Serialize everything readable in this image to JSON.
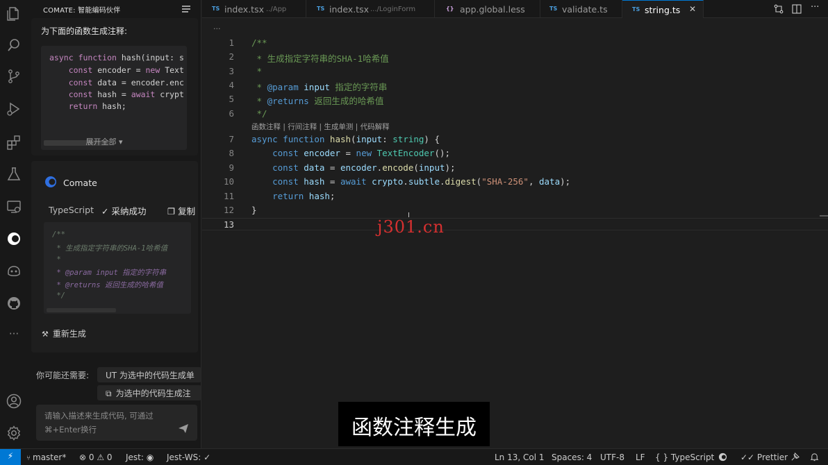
{
  "activity_bar": {
    "icons": [
      "explorer-icon",
      "search-icon",
      "source-control-icon",
      "run-debug-icon",
      "extensions-icon",
      "testing-icon",
      "remote-explorer-icon",
      "comate-icon",
      "copilot-icon",
      "github-icon",
      "more-icon",
      "account-icon",
      "settings-icon"
    ],
    "more_label": "···"
  },
  "side_panel": {
    "title": "COMATE: 智能编码伙伴",
    "user_message": {
      "prompt": "为下面的函数生成注释:",
      "code_lines": [
        "async function hash(input: s",
        "    const encoder = new Text",
        "    const data = encoder.enc",
        "    const hash = await crypt",
        "    return hash;"
      ],
      "expand_label": "展开全部 ▾"
    },
    "bot_message": {
      "name": "Comate",
      "language": "TypeScript",
      "accept_label": "✓ 采纳成功",
      "copy_label": "❐ 复制",
      "code_lines": [
        "/**",
        " * 生成指定字符串的SHA-1哈希值",
        " *",
        " * @param input 指定的字符串",
        " * @returns 返回生成的哈希值",
        " */"
      ],
      "regenerate_label": "重新生成"
    },
    "suggestions_label": "你可能还需要:",
    "suggestions": [
      "UT  为选中的代码生成单",
      "为选中的代码生成注"
    ],
    "prompt_placeholder_line1": "请输入描述来生成代码, 可通过",
    "prompt_placeholder_line2": "⌘+Enter换行"
  },
  "tabs": [
    {
      "badge": "TS",
      "name": "index.tsx",
      "path": "../App"
    },
    {
      "badge": "TS",
      "name": "index.tsx",
      "path": ".../LoginForm"
    },
    {
      "badge": "{}",
      "name": "app.global.less",
      "path": ""
    },
    {
      "badge": "TS",
      "name": "validate.ts",
      "path": ""
    },
    {
      "badge": "TS",
      "name": "string.ts",
      "path": "",
      "active": true
    }
  ],
  "tab_close": "✕",
  "editor": {
    "breadcrumb": "···",
    "line_numbers": [
      "1",
      "2",
      "3",
      "4",
      "5",
      "6",
      "7",
      "8",
      "9",
      "10",
      "11",
      "12",
      "13"
    ],
    "codelens": "函数注释 | 行间注释 | 生成单测 | 代码解释",
    "lines": [
      [
        {
          "t": "/**",
          "c": "com"
        }
      ],
      [
        {
          "t": " * 生成指定字符串的SHA-1哈希值",
          "c": "com"
        }
      ],
      [
        {
          "t": " *",
          "c": "com"
        }
      ],
      [
        {
          "t": " * ",
          "c": "com"
        },
        {
          "t": "@param",
          "c": "jsd"
        },
        {
          "t": " ",
          "c": "com"
        },
        {
          "t": "input",
          "c": "var"
        },
        {
          "t": " 指定的字符串",
          "c": "com"
        }
      ],
      [
        {
          "t": " * ",
          "c": "com"
        },
        {
          "t": "@returns",
          "c": "jsd"
        },
        {
          "t": " 返回生成的哈希值",
          "c": "com"
        }
      ],
      [
        {
          "t": " */",
          "c": "com"
        }
      ],
      [
        {
          "t": "async",
          "c": "key"
        },
        {
          "t": " ",
          "c": "pun"
        },
        {
          "t": "function",
          "c": "key"
        },
        {
          "t": " ",
          "c": "pun"
        },
        {
          "t": "hash",
          "c": "fn"
        },
        {
          "t": "(",
          "c": "pun"
        },
        {
          "t": "input",
          "c": "var"
        },
        {
          "t": ": ",
          "c": "pun"
        },
        {
          "t": "string",
          "c": "cls"
        },
        {
          "t": ") {",
          "c": "pun"
        }
      ],
      [
        {
          "t": "    ",
          "c": "pun"
        },
        {
          "t": "const",
          "c": "key"
        },
        {
          "t": " ",
          "c": "pun"
        },
        {
          "t": "encoder",
          "c": "var"
        },
        {
          "t": " = ",
          "c": "pun"
        },
        {
          "t": "new",
          "c": "key"
        },
        {
          "t": " ",
          "c": "pun"
        },
        {
          "t": "TextEncoder",
          "c": "cls"
        },
        {
          "t": "();",
          "c": "pun"
        }
      ],
      [
        {
          "t": "    ",
          "c": "pun"
        },
        {
          "t": "const",
          "c": "key"
        },
        {
          "t": " ",
          "c": "pun"
        },
        {
          "t": "data",
          "c": "var"
        },
        {
          "t": " = ",
          "c": "pun"
        },
        {
          "t": "encoder",
          "c": "var"
        },
        {
          "t": ".",
          "c": "pun"
        },
        {
          "t": "encode",
          "c": "fn"
        },
        {
          "t": "(",
          "c": "pun"
        },
        {
          "t": "input",
          "c": "var"
        },
        {
          "t": ");",
          "c": "pun"
        }
      ],
      [
        {
          "t": "    ",
          "c": "pun"
        },
        {
          "t": "const",
          "c": "key"
        },
        {
          "t": " ",
          "c": "pun"
        },
        {
          "t": "hash",
          "c": "var"
        },
        {
          "t": " = ",
          "c": "pun"
        },
        {
          "t": "await",
          "c": "key"
        },
        {
          "t": " ",
          "c": "pun"
        },
        {
          "t": "crypto",
          "c": "var"
        },
        {
          "t": ".",
          "c": "pun"
        },
        {
          "t": "subtle",
          "c": "var"
        },
        {
          "t": ".",
          "c": "pun"
        },
        {
          "t": "digest",
          "c": "fn"
        },
        {
          "t": "(",
          "c": "pun"
        },
        {
          "t": "\"SHA-256\"",
          "c": "str"
        },
        {
          "t": ", ",
          "c": "pun"
        },
        {
          "t": "data",
          "c": "var"
        },
        {
          "t": ");",
          "c": "pun"
        }
      ],
      [
        {
          "t": "    ",
          "c": "pun"
        },
        {
          "t": "return",
          "c": "key"
        },
        {
          "t": " ",
          "c": "pun"
        },
        {
          "t": "hash",
          "c": "var"
        },
        {
          "t": ";",
          "c": "pun"
        }
      ],
      [
        {
          "t": "}",
          "c": "pun"
        }
      ],
      [
        {
          "t": "",
          "c": "pun"
        }
      ]
    ],
    "watermark": "j301.cn",
    "subtitle": "函数注释生成"
  },
  "statusbar": {
    "remote": "⚡",
    "branch": "master*",
    "problems": "⊗ 0 ⚠ 0",
    "jest": "Jest:",
    "jest_ws": "Jest-WS: ✓",
    "position": "Ln 13, Col 1",
    "spaces": "Spaces: 4",
    "encoding": "UTF-8",
    "eol": "LF",
    "language": "{ } TypeScript",
    "prettier": "✓✓ Prettier"
  },
  "colors": {
    "accent": "#0078d4",
    "comment": "#6a9955",
    "keyword": "#569cd6",
    "variable": "#9cdcfe",
    "function": "#dcdcaa",
    "type": "#4ec9b0",
    "string": "#ce9178"
  }
}
